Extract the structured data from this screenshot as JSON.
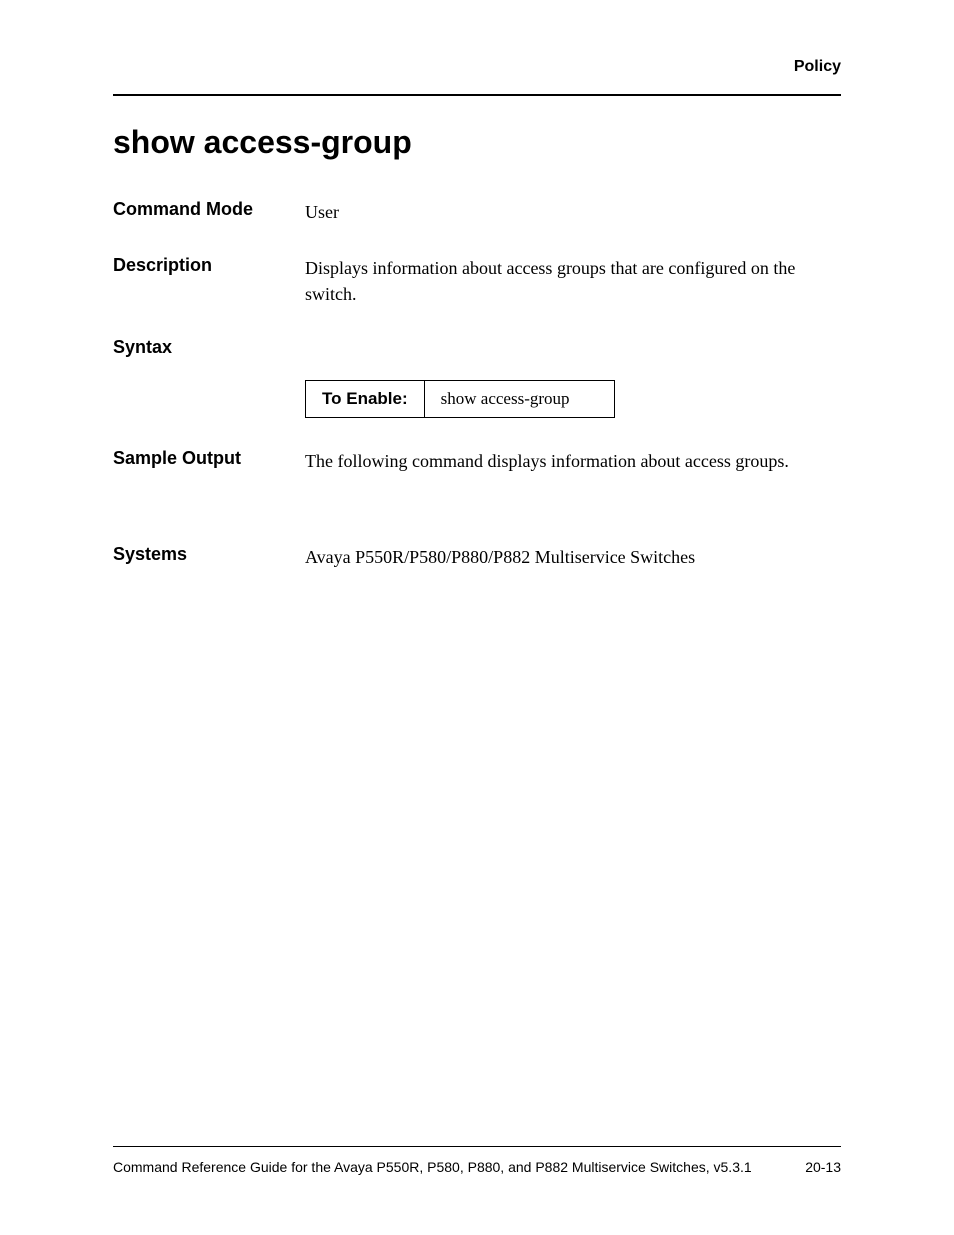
{
  "header": {
    "section": "Policy"
  },
  "title": "show access-group",
  "rows": {
    "command_mode": {
      "label": "Command Mode",
      "value": "User"
    },
    "description": {
      "label": "Description",
      "value": "Displays information about access groups that are configured on the switch."
    },
    "syntax": {
      "label": "Syntax"
    },
    "sample_output": {
      "label": "Sample Output",
      "value": "The following command displays information about access groups."
    },
    "systems": {
      "label": "Systems",
      "value": "Avaya P550R/P580/P880/P882 Multiservice Switches"
    }
  },
  "syntax_table": {
    "enable_label": "To Enable:",
    "enable_value": "show access-group"
  },
  "footer": {
    "guide": "Command Reference Guide for the Avaya P550R, P580, P880, and P882 Multiservice Switches, v5.3.1",
    "page": "20-13"
  }
}
